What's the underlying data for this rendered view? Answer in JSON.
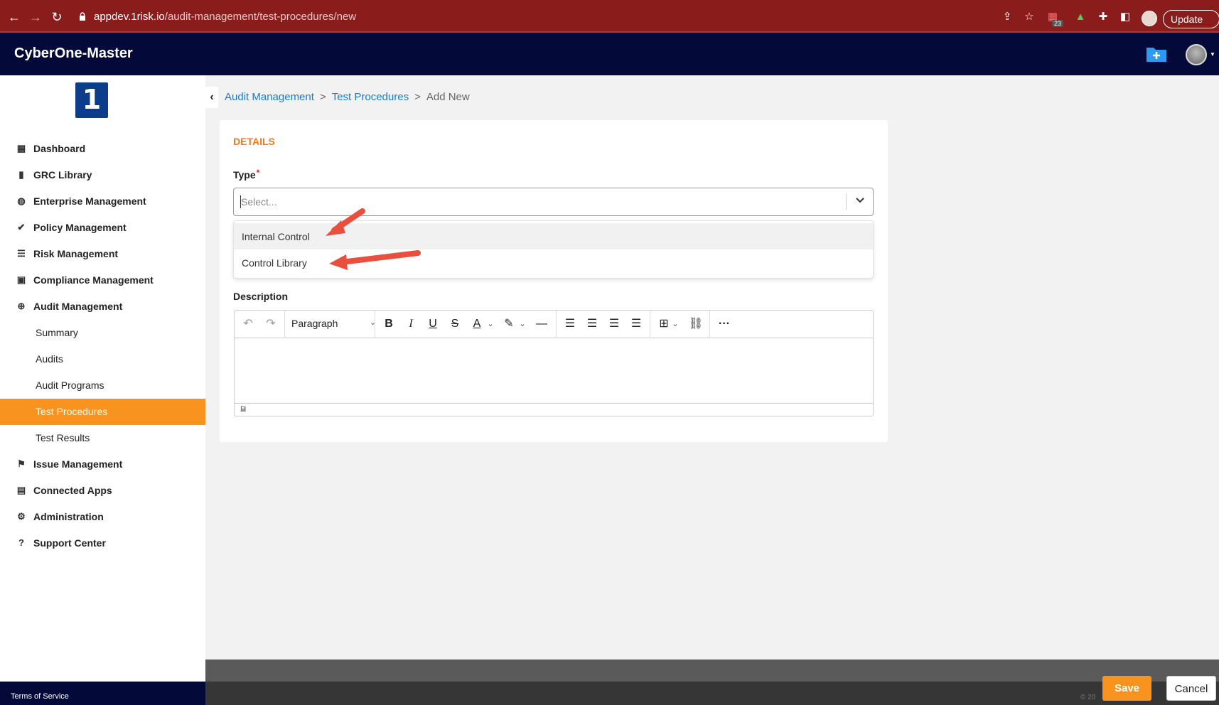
{
  "browser": {
    "url_host": "appdev.1risk.io",
    "url_path": "/audit-management/test-procedures/new",
    "badge_count": "23",
    "update_label": "Update"
  },
  "header": {
    "title": "CyberOne-Master",
    "logo_text": "1"
  },
  "sidebar": {
    "items": [
      {
        "label": "Dashboard",
        "icon": "grid-icon"
      },
      {
        "label": "GRC Library",
        "icon": "book-icon"
      },
      {
        "label": "Enterprise Management",
        "icon": "globe-icon"
      },
      {
        "label": "Policy Management",
        "icon": "double-check-icon"
      },
      {
        "label": "Risk Management",
        "icon": "list-icon"
      },
      {
        "label": "Compliance Management",
        "icon": "clipboard-check-icon"
      },
      {
        "label": "Audit Management",
        "icon": "crosshair-icon"
      },
      {
        "label": "Summary"
      },
      {
        "label": "Audits"
      },
      {
        "label": "Audit Programs"
      },
      {
        "label": "Test Procedures",
        "active": true
      },
      {
        "label": "Test Results"
      },
      {
        "label": "Issue Management",
        "icon": "flag-icon"
      },
      {
        "label": "Connected Apps",
        "icon": "store-icon"
      },
      {
        "label": "Administration",
        "icon": "gear-icon"
      },
      {
        "label": "Support Center",
        "icon": "question-icon"
      }
    ],
    "footer": "Terms of Service"
  },
  "breadcrumb": {
    "items": [
      "Audit Management",
      "Test Procedures"
    ],
    "separator": ">",
    "current": "Add New"
  },
  "form": {
    "section_title": "DETAILS",
    "type_label": "Type",
    "required_mark": "*",
    "type_placeholder": "Select...",
    "type_options": [
      "Internal Control",
      "Control Library"
    ],
    "description_label": "Description",
    "editor": {
      "block_format": "Paragraph",
      "status_path": "P"
    }
  },
  "footer": {
    "copyright": "© 20",
    "save_label": "Save",
    "cancel_label": "Cancel"
  },
  "colors": {
    "brand_navy": "#030a3a",
    "accent_orange": "#f7931e",
    "link_blue": "#1a7ad6",
    "browser_red": "#8b1c1c",
    "annotation_red": "#ea4f3d"
  }
}
